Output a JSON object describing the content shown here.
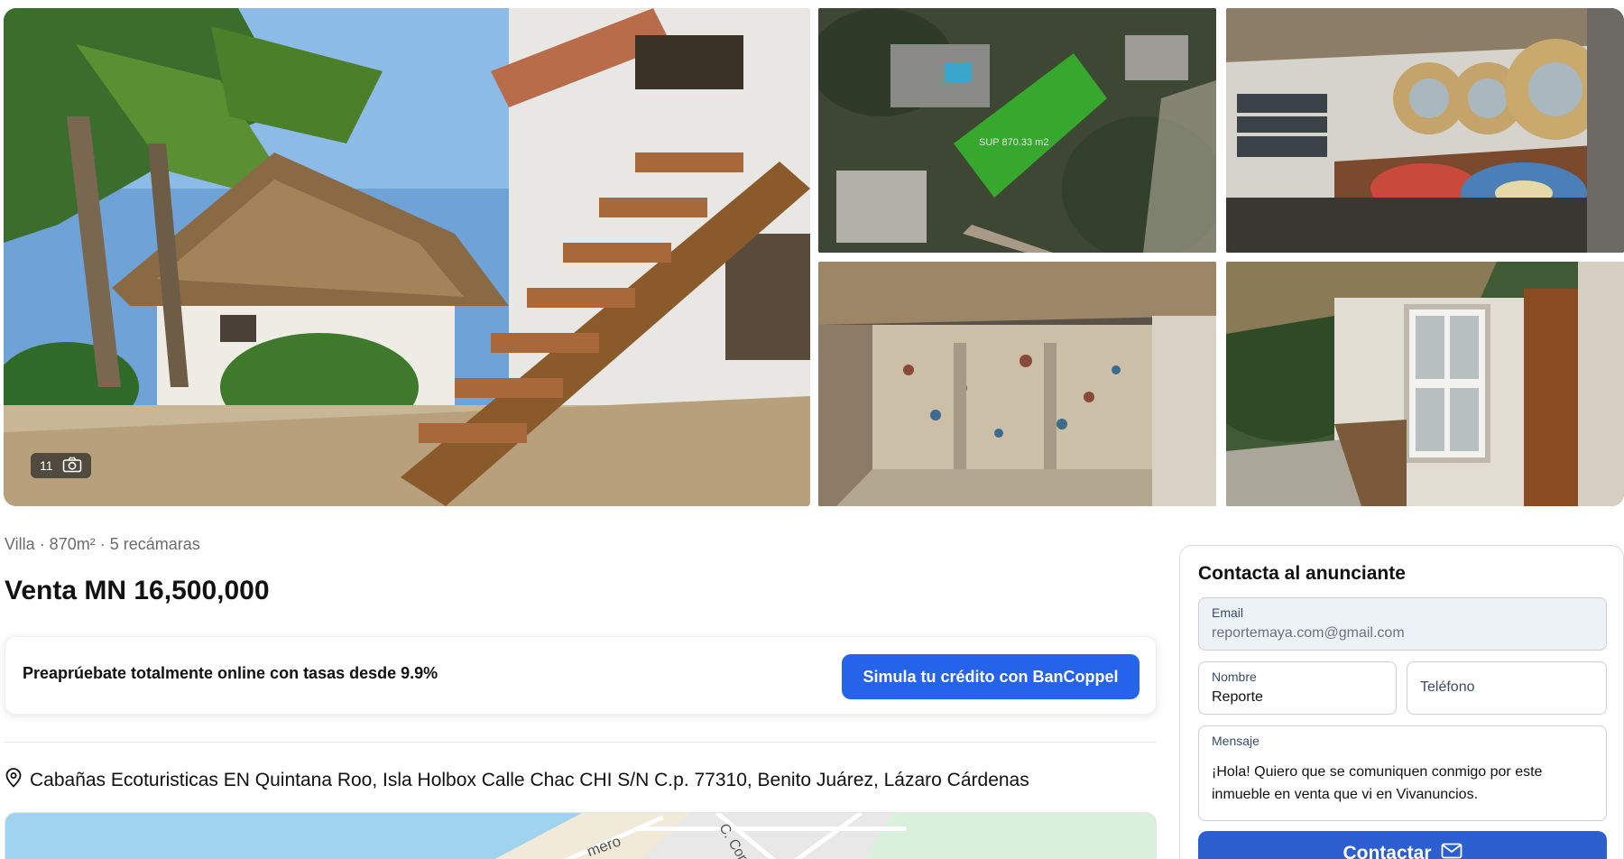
{
  "gallery": {
    "photo_count": "11",
    "map_label": "SUP  870.33 m2"
  },
  "listing": {
    "subtitle": "Villa · 870m² · 5 recámaras",
    "price": "Venta MN 16,500,000",
    "credit_text": "Preaprúebate totalmente online con tasas desde 9.9%",
    "credit_button": "Simula tu crédito con BanCoppel",
    "address": "Cabañas Ecoturisticas EN Quintana Roo, Isla Holbox Calle Chac CHI S/N C.p. 77310, Benito Juárez, Lázaro Cárdenas",
    "map_street_1": "mero",
    "map_street_2": "C. Corvin"
  },
  "contact": {
    "title": "Contacta al anunciante",
    "email_label": "Email",
    "email_value": "reportemaya.com@gmail.com",
    "nombre_label": "Nombre",
    "nombre_value": "Reporte",
    "telefono_placeholder": "Teléfono",
    "mensaje_label": "Mensaje",
    "mensaje_value": "¡Hola! Quiero que se comuniquen conmigo por este inmueble en venta que vi en Vivanuncios.",
    "button_label": "Contactar"
  },
  "colors": {
    "primary_button": "#2563eb",
    "contact_button": "#2b5fd0",
    "email_field_bg": "#edf2f7"
  }
}
